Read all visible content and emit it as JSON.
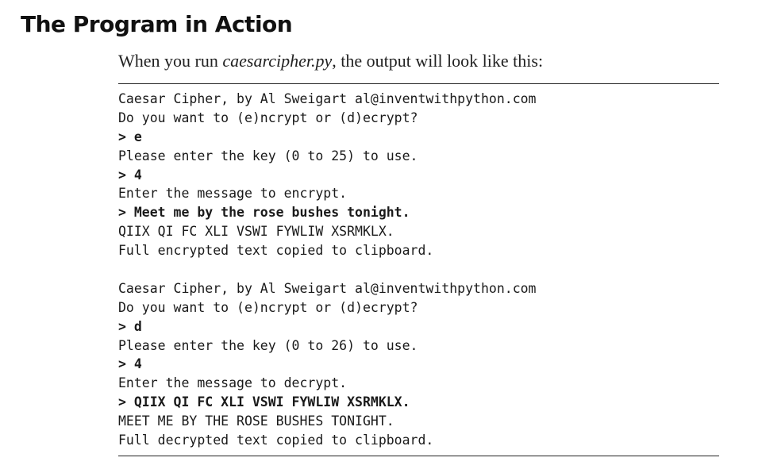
{
  "heading": "The Program in Action",
  "intro": {
    "before": "When you run ",
    "filename": "caesarcipher.py",
    "after": ", the output will look like this:"
  },
  "output_lines": [
    {
      "text": "Caesar Cipher, by Al Sweigart al@inventwithpython.com",
      "kind": "program"
    },
    {
      "text": "Do you want to (e)ncrypt or (d)ecrypt?",
      "kind": "program"
    },
    {
      "text": "> e",
      "kind": "user"
    },
    {
      "text": "Please enter the key (0 to 25) to use.",
      "kind": "program"
    },
    {
      "text": "> 4",
      "kind": "user"
    },
    {
      "text": "Enter the message to encrypt.",
      "kind": "program"
    },
    {
      "text": "> Meet me by the rose bushes tonight.",
      "kind": "user"
    },
    {
      "text": "QIIX QI FC XLI VSWI FYWLIW XSRMKLX.",
      "kind": "program"
    },
    {
      "text": "Full encrypted text copied to clipboard.",
      "kind": "program"
    },
    {
      "text": "",
      "kind": "blank"
    },
    {
      "text": "Caesar Cipher, by Al Sweigart al@inventwithpython.com",
      "kind": "program"
    },
    {
      "text": "Do you want to (e)ncrypt or (d)ecrypt?",
      "kind": "program"
    },
    {
      "text": "> d",
      "kind": "user"
    },
    {
      "text": "Please enter the key (0 to 26) to use.",
      "kind": "program"
    },
    {
      "text": "> 4",
      "kind": "user"
    },
    {
      "text": "Enter the message to decrypt.",
      "kind": "program"
    },
    {
      "text": "> QIIX QI FC XLI VSWI FYWLIW XSRMKLX.",
      "kind": "user"
    },
    {
      "text": "MEET ME BY THE ROSE BUSHES TONIGHT.",
      "kind": "program"
    },
    {
      "text": "Full decrypted text copied to clipboard.",
      "kind": "program"
    }
  ]
}
